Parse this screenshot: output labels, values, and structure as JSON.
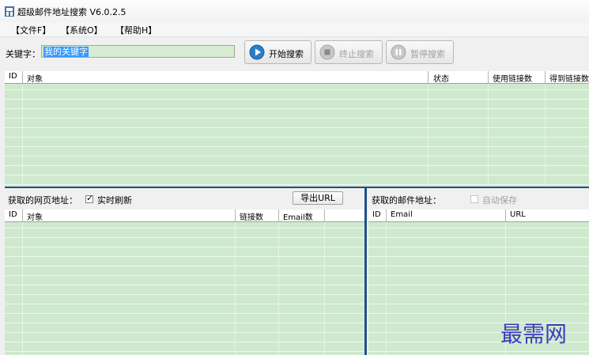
{
  "window": {
    "title": "超级邮件地址搜索 V6.0.2.5"
  },
  "menu": [
    {
      "label": "【文件F】"
    },
    {
      "label": "【系统O】"
    },
    {
      "label": "【帮助H】"
    }
  ],
  "toolbar": {
    "keyword_label": "关键字：",
    "keyword_value": "我的关键字",
    "start_label": "开始搜索",
    "stop_label": "终止搜索",
    "pause_label": "暂停搜索"
  },
  "top_table": {
    "columns": [
      "ID",
      "对象",
      "状态",
      "使用链接数",
      "得到链接数"
    ],
    "rows": []
  },
  "pages_pane": {
    "label": "获取的网页地址：",
    "realtime_label": "实时刷新",
    "realtime_checked": true,
    "export_label": "导出URL",
    "columns": [
      "ID",
      "对象",
      "链接数",
      "Email数"
    ],
    "rows": []
  },
  "emails_pane": {
    "label": "获取的邮件地址：",
    "autosave_label": "自动保存",
    "autosave_checked": false,
    "columns": [
      "ID",
      "Email",
      "URL"
    ],
    "rows": []
  },
  "watermark": "最需网",
  "colors": {
    "grid": "#cfe9cf",
    "selection": "#3399ff",
    "divider": "#1f4f8c",
    "watermark": "#3c3cc0"
  },
  "icons": {
    "start": "play-icon",
    "stop": "stop-icon",
    "pause": "pause-icon"
  }
}
